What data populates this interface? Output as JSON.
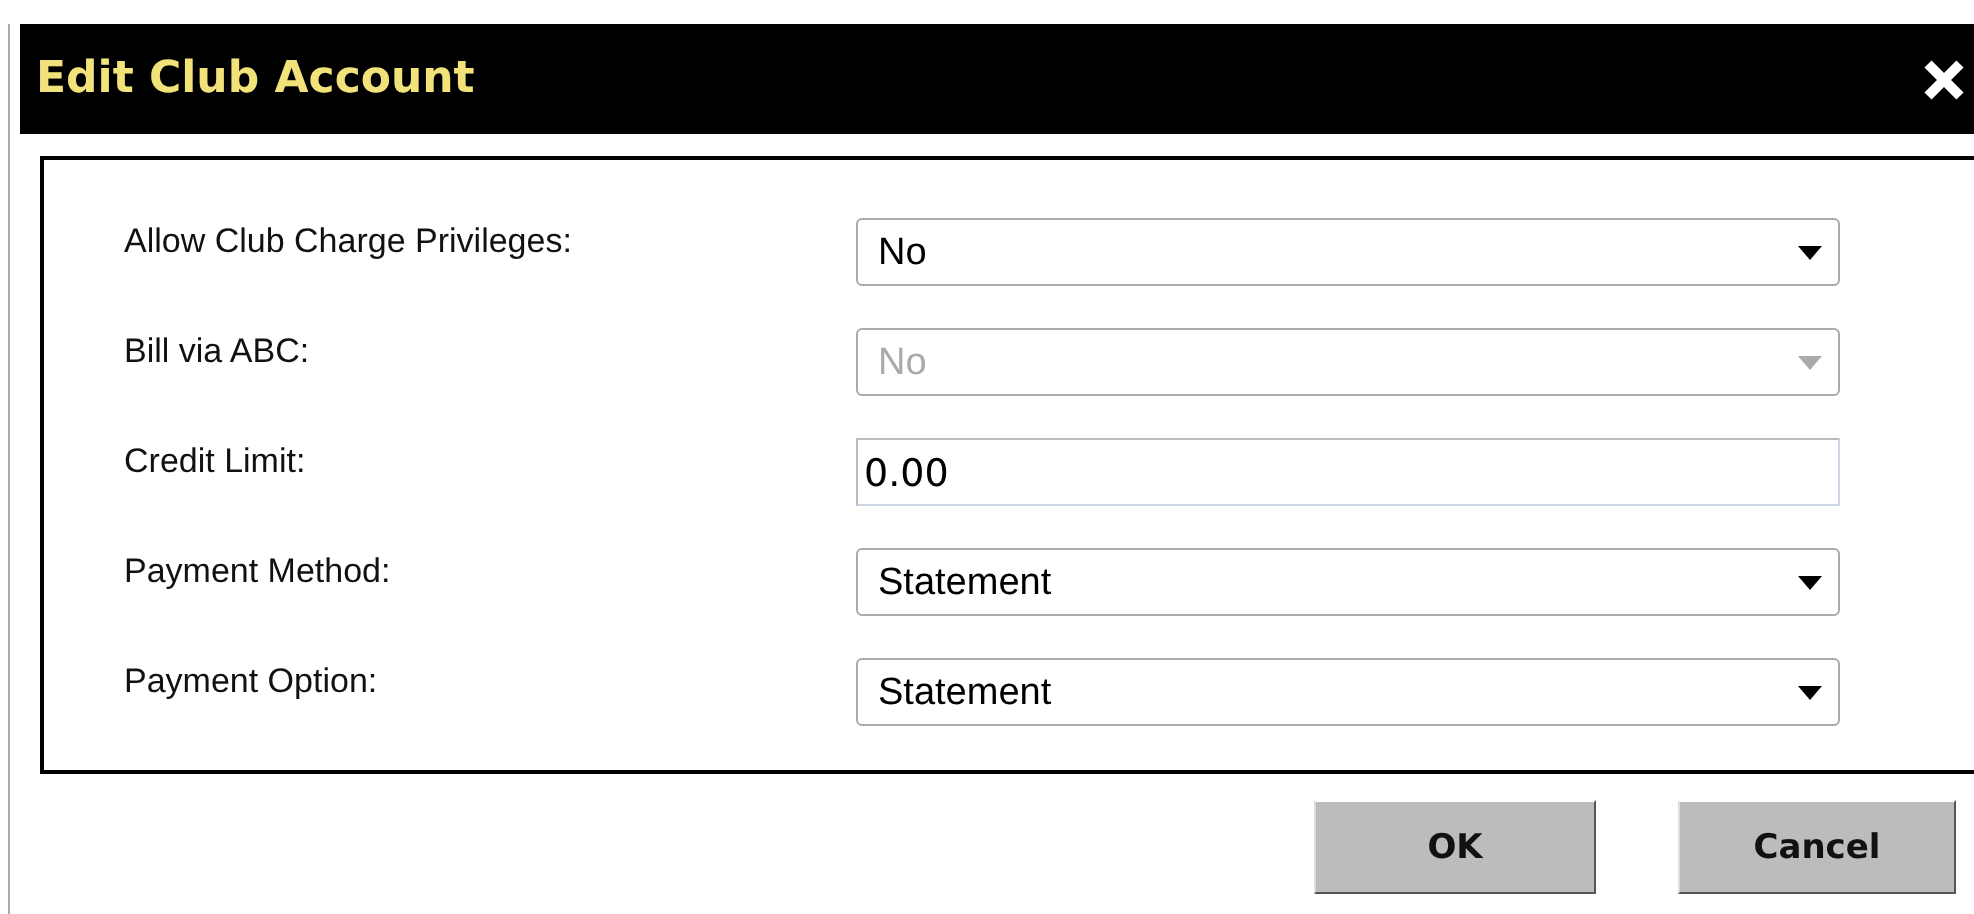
{
  "window": {
    "title": "Edit Club Account"
  },
  "fields": [
    {
      "label": "Allow Club Charge Privileges:",
      "kind": "select",
      "value": "No",
      "disabled": false
    },
    {
      "label": "Bill via ABC:",
      "kind": "select",
      "value": "No",
      "disabled": true
    },
    {
      "label": "Credit Limit:",
      "kind": "text",
      "value": "0.00",
      "disabled": false
    },
    {
      "label": "Payment Method:",
      "kind": "select",
      "value": "Statement",
      "disabled": false
    },
    {
      "label": "Payment Option:",
      "kind": "select",
      "value": "Statement",
      "disabled": false
    }
  ],
  "buttons": [
    "OK",
    "Cancel"
  ]
}
